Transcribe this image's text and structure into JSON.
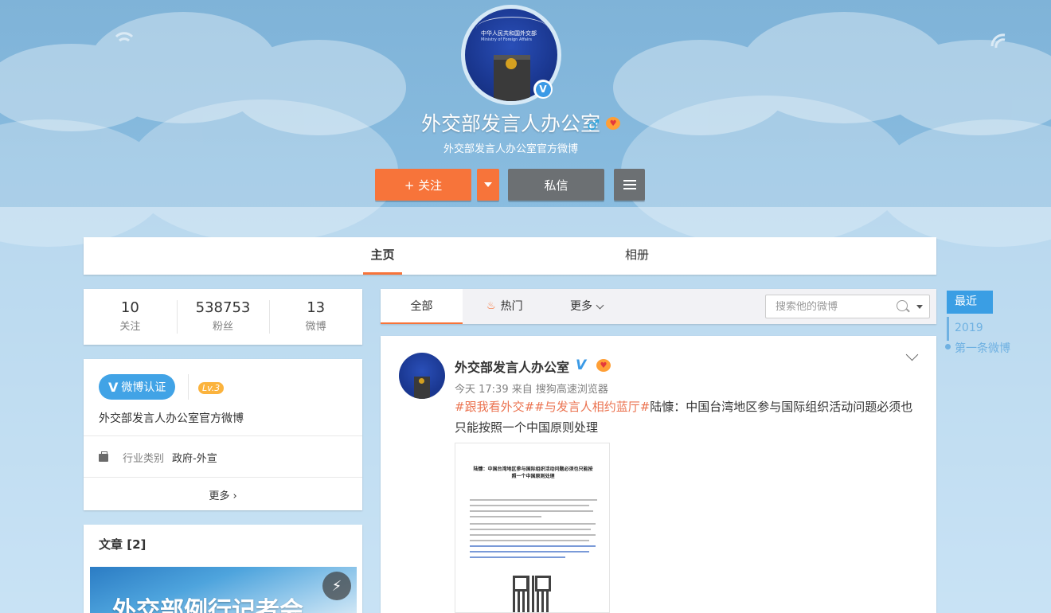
{
  "profile": {
    "avatar_text_1": "中华人民共和国外交部",
    "avatar_text_2": "Ministry of Foreign Affairs",
    "name": "外交部发言人办公室",
    "gender_icon": "♂",
    "description": "外交部发言人办公室官方微博",
    "verified_icon": "V"
  },
  "actions": {
    "follow_label": "+ 关注",
    "message_label": "私信"
  },
  "tabs": [
    {
      "label": "主页",
      "active": true
    },
    {
      "label": "相册",
      "active": false
    }
  ],
  "stats": [
    {
      "value": "10",
      "label": "关注"
    },
    {
      "value": "538753",
      "label": "粉丝"
    },
    {
      "value": "13",
      "label": "微博"
    }
  ],
  "info": {
    "cert_badge_icon": "V",
    "cert_badge": "微博认证",
    "level": "Lv.3",
    "description": "外交部发言人办公室官方微博",
    "industry_label": "行业类别",
    "industry_value": "政府-外宣",
    "more_label": "更多 ›"
  },
  "articles": {
    "title": "文章 [2]",
    "image_text": "外交部例行记者会",
    "flash_icon": "⚡"
  },
  "feed": {
    "tabs": {
      "all": "全部",
      "hot": "热门",
      "more": "更多"
    },
    "search_placeholder": "搜索他的微博"
  },
  "post": {
    "author": "外交部发言人办公室",
    "verified": "V",
    "meta": "今天 17:39 来自 搜狗高速浏览器",
    "tag1": "#跟我看外交#",
    "tag2": "#与发言人相约蓝厅#",
    "text": "陆慷：中国台湾地区参与国际组织活动问题必须也只能按照一个中国原则处理",
    "image_title": "陆慷：中国台湾地区参与国际组织活动问题必须也只能按照一个中国原则处理"
  },
  "timeline": {
    "recent": "最近",
    "year": "2019",
    "first": "第一条微博"
  },
  "colors": {
    "accent": "#f7743a",
    "link_blue": "#3b9ae6",
    "tag": "#eb7350"
  }
}
